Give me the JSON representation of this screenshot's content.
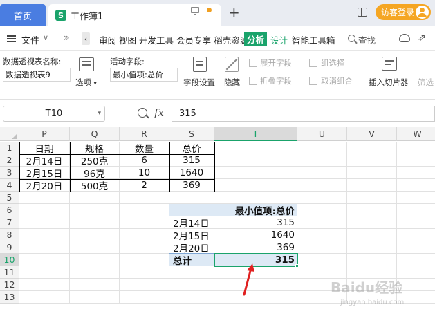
{
  "titlebar": {
    "home_tab": "首页",
    "doc_logo": "S",
    "doc_tab": "工作簿1",
    "plus": "+",
    "login": "访客登录"
  },
  "menubar": {
    "file": "文件",
    "chevron": "∨",
    "more": "»",
    "scroll_left": "‹",
    "items": [
      "审阅",
      "视图",
      "开发工具",
      "会员专享",
      "稻壳资源"
    ],
    "analyze": "分析",
    "design": "设计",
    "smart_toolbox": "智能工具箱",
    "search": "查找",
    "share_glyph": "⇗"
  },
  "ribbon": {
    "pivot_name_label": "数据透视表名称:",
    "pivot_name_value": "数据透视表9",
    "options": "选项",
    "options_arrow": "▾",
    "active_field_label": "活动字段:",
    "active_field_value": "最小值项:总价",
    "field_settings": "字段设置",
    "hide": "隐藏",
    "expand_field": "展开字段",
    "collapse_field": "折叠字段",
    "group_selection": "组选择",
    "ungroup": "取消组合",
    "insert_slicer": "插入切片器",
    "filter": "筛选"
  },
  "formulabar": {
    "name_box": "T10",
    "name_box_arrow": "▾",
    "fx": "fx",
    "formula": "315"
  },
  "grid": {
    "columns": [
      "P",
      "Q",
      "R",
      "S",
      "T",
      "U",
      "V",
      "W"
    ],
    "rows": [
      "1",
      "2",
      "3",
      "4",
      "5",
      "6",
      "7",
      "8",
      "9",
      "10",
      "11",
      "12",
      "13"
    ],
    "selected_column": "T",
    "selected_row": "10",
    "source_table": {
      "headers": [
        "日期",
        "规格",
        "数量",
        "总价"
      ],
      "rows": [
        [
          "2月14日",
          "250克",
          "6",
          "315"
        ],
        [
          "2月15日",
          "96克",
          "10",
          "1640"
        ],
        [
          "2月20日",
          "500克",
          "2",
          "369"
        ]
      ]
    },
    "pivot": {
      "header": "最小值项:总价",
      "rows": [
        [
          "2月14日",
          "315"
        ],
        [
          "2月15日",
          "1640"
        ],
        [
          "2月20日",
          "369"
        ]
      ],
      "total_label": "总计",
      "total_value": "315"
    }
  },
  "watermark": {
    "main": "Baidu经验",
    "sub": "jingyan.baidu.com"
  },
  "colors": {
    "accent": "#1aa36b",
    "home_tab": "#4a7de1",
    "login": "#f5a623",
    "arrow": "#e02020",
    "pivot_bg": "#dde9f5"
  }
}
